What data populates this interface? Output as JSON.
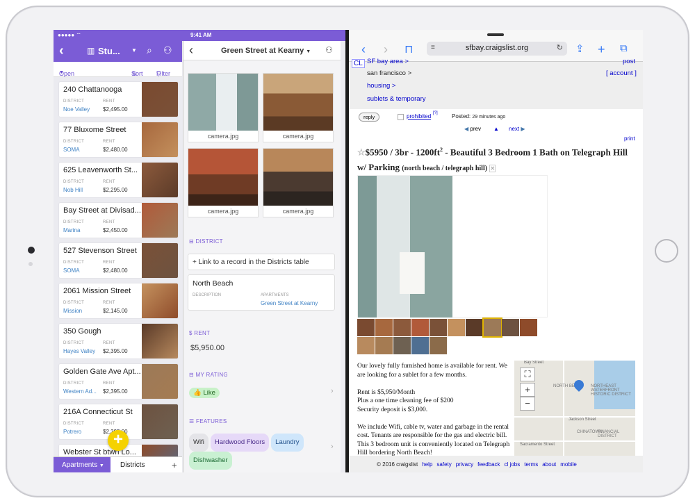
{
  "status_bar": {
    "left": "●●●●● ⌔",
    "time": "9:41 AM",
    "battery": "100%"
  },
  "app": {
    "nav": {
      "title": "Stu...",
      "view_label": "Open Apartments",
      "sort_label": "Sort",
      "filter_label": "Filter"
    },
    "field_labels": {
      "district": "DISTRICT",
      "rent": "RENT"
    },
    "records": [
      {
        "name": "240 Chattanooga",
        "district": "Noe Valley",
        "rent": "$2,495.00"
      },
      {
        "name": "77 Bluxome Street",
        "district": "SOMA",
        "rent": "$2,480.00"
      },
      {
        "name": "625 Leavenworth St...",
        "district": "Nob Hill",
        "rent": "$2,295.00"
      },
      {
        "name": "Bay Street at Divisad...",
        "district": "Marina",
        "rent": "$2,450.00"
      },
      {
        "name": "527 Stevenson Street",
        "district": "SOMA",
        "rent": "$2,480.00"
      },
      {
        "name": "2061 Mission Street",
        "district": "Mission",
        "rent": "$2,145.00"
      },
      {
        "name": "350 Gough",
        "district": "Hayes Valley",
        "rent": "$2,395.00"
      },
      {
        "name": "Golden Gate Ave Apt...",
        "district": "Western Ad...",
        "rent": "$2,395.00"
      },
      {
        "name": "216A Connecticut St",
        "district": "Potrero",
        "rent": "$2,395.00"
      },
      {
        "name": "Webster St btwn Lo...",
        "district": "",
        "rent": ""
      }
    ],
    "tabs": {
      "active": "Apartments",
      "other": "Districts",
      "add": "+"
    }
  },
  "detail": {
    "title": "Green Street at Kearny",
    "photos": [
      "camera.jpg",
      "camera.jpg",
      "camera.jpg",
      "camera.jpg"
    ],
    "district_section": "DISTRICT",
    "link_record": "+ Link to a record in the Districts table",
    "district_name": "North Beach",
    "description_label": "DESCRIPTION",
    "apartments_label": "APARTMENTS",
    "apartments_value": "Green Street at Kearny",
    "rent_section": "RENT",
    "rent_value": "$5,950.00",
    "rating_section": "MY RATING",
    "rating_value": "👍 Like",
    "features_section": "FEATURES",
    "features": [
      "Wifi",
      "Hardwood Floors",
      "Laundry",
      "Dishwasher"
    ]
  },
  "browser": {
    "url": "sfbay.craigslist.org",
    "breadcrumb": {
      "logo": "CL",
      "region": "SF bay area >",
      "city": "san francisco >",
      "category": "housing >",
      "subcategory": "sublets & temporary"
    },
    "post_link": "post",
    "account_link": "[ account ]",
    "reply": "reply",
    "prohibited": "prohibited",
    "prohibited_sup": "[?]",
    "posted": "Posted:",
    "posted_time": "29 minutes ago",
    "prev": "prev",
    "next": "next",
    "print": "print",
    "title_main": "$5950 / 3br - 1200ft",
    "title_sup": "2",
    "title_rest": " - Beautiful 3 Bedroom 1 Bath on Telegraph Hill w/ Parking",
    "title_loc": "(north beach / telegraph hill)",
    "body": [
      "Our lovely fully furnished home is available for rent. We are looking for a sublet for a few months.",
      "Rent is $5,950/Month",
      "Plus a one time cleaning fee of $200",
      "Security deposit is $3,000.",
      "We include Wifi, cable tv, water and garbage in the rental cost. Tenants are responsible for the gas and electric bill. This 3 bedroom unit is conveniently located on Telegraph Hill bordering North Beach!"
    ],
    "map_labels": [
      "Bay Street",
      "NORTH BEACH",
      "NORTHEAST WATERFRONT HISTORIC DISTRICT",
      "Jackson Street",
      "CHINATOWN",
      "FINANCIAL DISTRICT",
      "Sacramento Street"
    ],
    "footer": [
      "© 2016 craigslist",
      "help",
      "safety",
      "privacy",
      "feedback",
      "cl jobs",
      "terms",
      "about",
      "mobile"
    ]
  },
  "colors": {
    "accent": "#7b5cd6",
    "link": "#0000cc",
    "fab": "#f5d200"
  }
}
